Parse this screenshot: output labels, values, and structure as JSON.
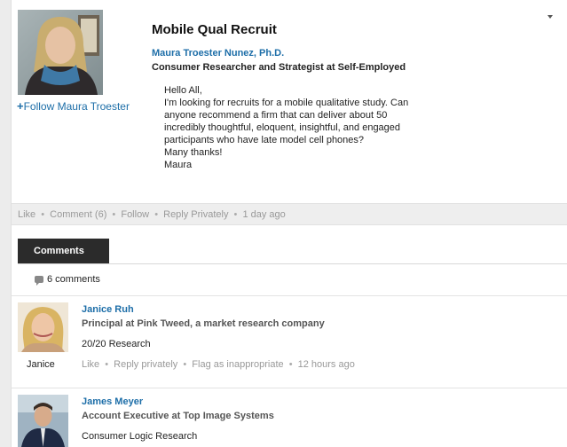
{
  "post": {
    "title": "Mobile Qual Recruit",
    "author_name": "Maura Troester Nunez, Ph.D.",
    "author_headline": "Consumer Researcher and Strategist at Self-Employed",
    "follow_link": "Follow Maura Troester",
    "body_lines": [
      "Hello All,",
      "I'm looking for recruits for a mobile qualitative study. Can",
      "anyone recommend a firm that can deliver about 50",
      "incredibly thoughtful, eloquent, insightful, and engaged",
      "participants who have late model cell phones?",
      "Many thanks!",
      "Maura"
    ]
  },
  "post_actions": {
    "like": "Like",
    "comment": "Comment (6)",
    "follow": "Follow",
    "reply_privately": "Reply Privately",
    "timestamp": "1 day ago"
  },
  "comments_tab": {
    "label": "Comments"
  },
  "comment_count": "6 comments",
  "comments": [
    {
      "name": "Janice Ruh",
      "headline": "Principal at Pink Tweed, a market research company",
      "company": "20/20 Research",
      "caption": "Janice",
      "like": "Like",
      "reply_privately": "Reply privately",
      "flag": "Flag as inappropriate",
      "timestamp": "12 hours ago"
    },
    {
      "name": "James Meyer",
      "headline": "Account Executive at Top Image Systems",
      "company": "Consumer Logic Research"
    }
  ],
  "colors": {
    "link_blue": "#1d6ea8",
    "tab_dark": "#2b2b2b",
    "action_bar_bg": "#eeeeee"
  }
}
